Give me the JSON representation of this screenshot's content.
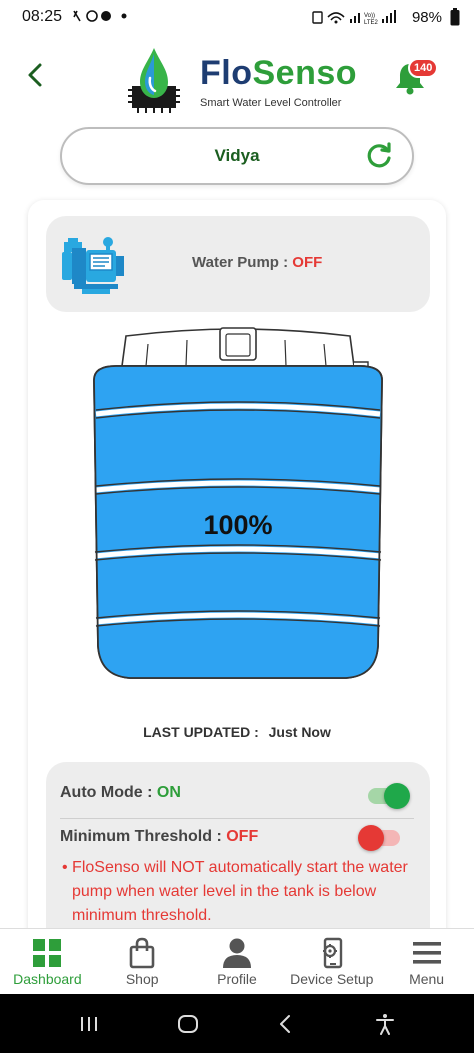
{
  "status_bar": {
    "time": "08:25",
    "network_label": "Vo)) LTE2",
    "battery": "98%"
  },
  "header": {
    "logo_part1": "Flo",
    "logo_part2": "Senso",
    "logo_subtitle": "Smart Water Level Controller",
    "notification_count": "140"
  },
  "device": {
    "name": "Vidya"
  },
  "pump": {
    "label": "Water Pump :",
    "status": "OFF"
  },
  "tank": {
    "level_text": "100%",
    "level_fraction": 1.0,
    "water_color": "#2ea3f2"
  },
  "last_updated": {
    "label": "LAST UPDATED :",
    "value": "Just Now"
  },
  "auto_mode": {
    "label": "Auto Mode :",
    "status": "ON",
    "enabled": true
  },
  "min_threshold": {
    "label": "Minimum Threshold :",
    "status": "OFF",
    "enabled": false,
    "warning": "• FloSenso will NOT automatically start the water pump when water level in the tank is below minimum threshold."
  },
  "bottom_nav": [
    {
      "label": "Dashboard",
      "icon": "grid-icon",
      "active": true
    },
    {
      "label": "Shop",
      "icon": "shopping-bag-icon",
      "active": false
    },
    {
      "label": "Profile",
      "icon": "person-icon",
      "active": false
    },
    {
      "label": "Device Setup",
      "icon": "device-setup-icon",
      "active": false
    },
    {
      "label": "Menu",
      "icon": "menu-icon",
      "active": false
    }
  ],
  "colors": {
    "brand_green": "#2e9e3a",
    "brand_blue": "#1e3d72",
    "off_red": "#e53935",
    "water_blue": "#2ea3f2"
  }
}
